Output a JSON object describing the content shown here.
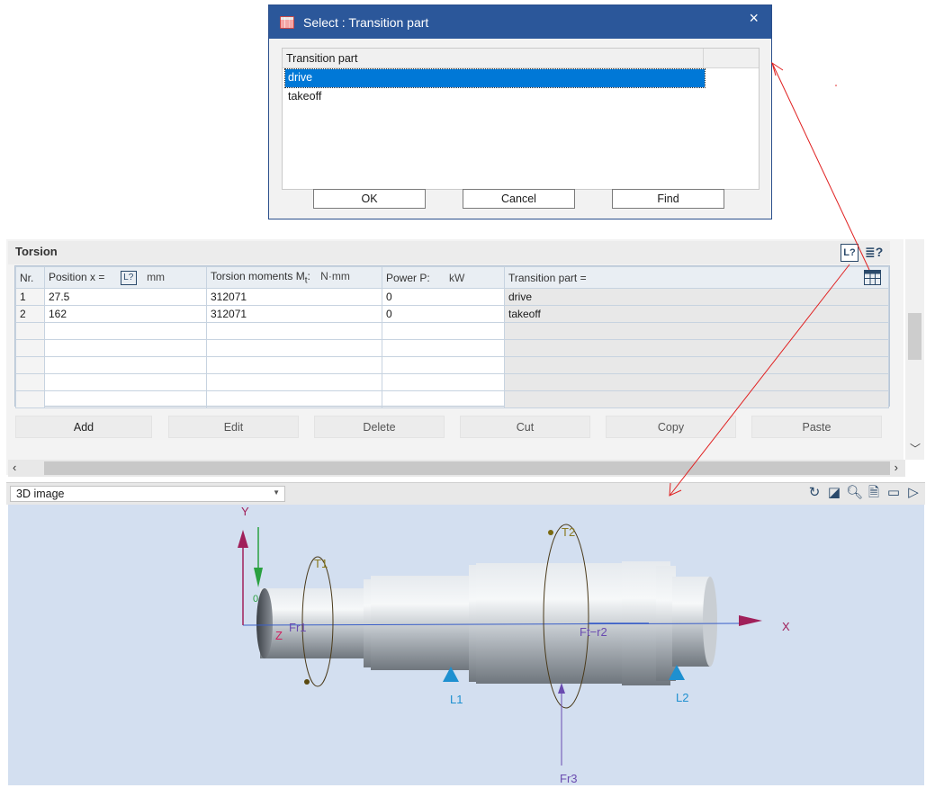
{
  "dialog": {
    "title": "Select : Transition part",
    "close": "×",
    "column_header": "Transition part",
    "items": [
      "drive",
      "takeoff"
    ],
    "selected": "drive",
    "buttons": {
      "ok": "OK",
      "cancel": "Cancel",
      "find": "Find"
    }
  },
  "torsion": {
    "title": "Torsion",
    "columns": {
      "nr": "Nr.",
      "position": "Position x =",
      "position_unit": "mm",
      "torsion_prefix": "Torsion moments M",
      "torsion_sub": "t",
      "torsion_suffix": ":",
      "torsion_unit": "N·mm",
      "power": "Power P:",
      "power_unit": "kW",
      "transition": "Transition  part ="
    },
    "rows": [
      {
        "nr": "1",
        "position": "27.5",
        "moment": "312071",
        "power": "0",
        "transition": "drive"
      },
      {
        "nr": "2",
        "position": "162",
        "moment": "312071",
        "power": "0",
        "transition": "takeoff"
      }
    ],
    "buttons": {
      "add": "Add",
      "edit": "Edit",
      "delete": "Delete",
      "cut": "Cut",
      "copy": "Copy",
      "paste": "Paste"
    }
  },
  "view3d": {
    "selected_view": "3D image",
    "labels": {
      "y": "Y",
      "x": "X",
      "z": "Z",
      "t1": "T1",
      "t2": "T2",
      "fr1": "Fr1",
      "fr3": "Fr3",
      "fr2_overlap": "Ft−r2",
      "l1": "L1",
      "l2": "L2",
      "zero": "0"
    }
  },
  "colors": {
    "title_bar": "#2b579a",
    "selection": "#0078d7",
    "viewport_bg": "#d3dff0",
    "support": "#1e90d0",
    "force": "#6a4bb0",
    "y_axis": "#a0205a",
    "annotation_line": "#e02020"
  }
}
